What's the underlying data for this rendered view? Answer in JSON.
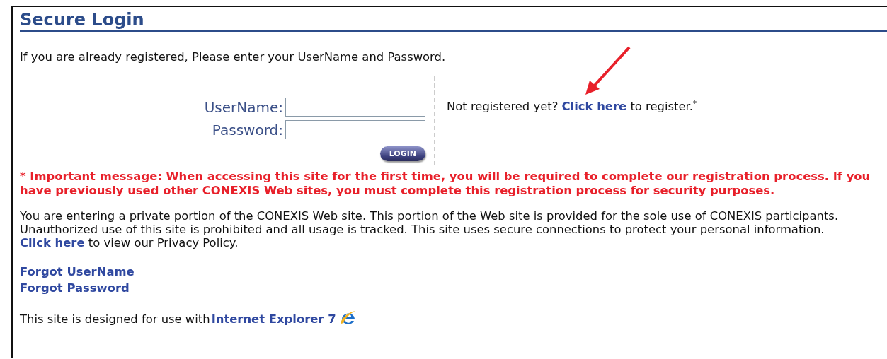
{
  "title": "Secure Login",
  "intro": "If you are already registered, Please enter your UserName and Password.",
  "fields": [
    {
      "label": "UserName:"
    },
    {
      "label": "Password:"
    }
  ],
  "login_button": "LOGIN",
  "register": {
    "before": "Not registered yet? ",
    "link": "Click here",
    "after": " to register.$^{*}$"
  },
  "important": "* Important message: When accessing this site for the first time, you will be required to complete our registration process. If you have previously used other CONEXIS Web sites, you must complete this registration process for security purposes.",
  "privacy": {
    "before": "You are entering a private portion of the CONEXIS Web site. This portion of the Web site is provided for the sole use of CONEXIS participants. Unauthorized use of this site is prohibited and all usage is tracked. This site uses secure connections to protect your personal information. ",
    "link": "Click here",
    "after": " to view our Privacy Policy."
  },
  "links": [
    "Forgot UserName",
    "Forgot Password"
  ],
  "footer": {
    "before": "This site is designed for use with ",
    "link": "Internet Explorer 7"
  }
}
